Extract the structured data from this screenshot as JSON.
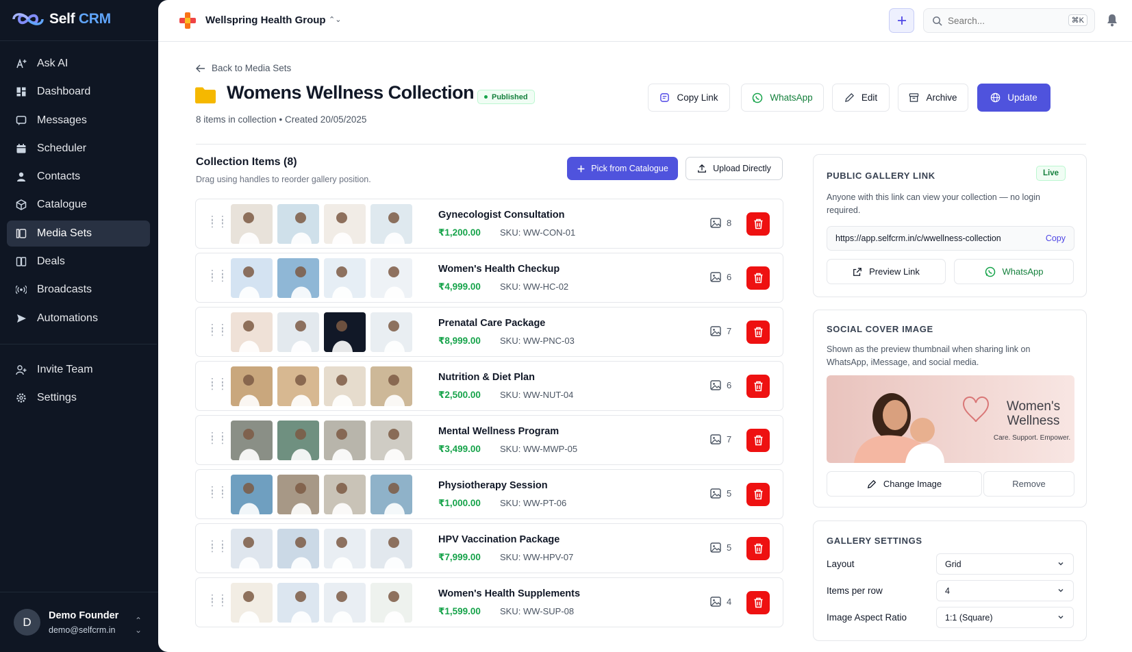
{
  "brand": {
    "name_a": "Self",
    "name_b": "CRM"
  },
  "sidebar": {
    "items": [
      {
        "label": "Ask AI",
        "icon": "sparkle-text-icon"
      },
      {
        "label": "Dashboard",
        "icon": "dashboard-icon"
      },
      {
        "label": "Messages",
        "icon": "messages-icon"
      },
      {
        "label": "Scheduler",
        "icon": "calendar-icon"
      },
      {
        "label": "Contacts",
        "icon": "user-icon"
      },
      {
        "label": "Catalogue",
        "icon": "package-icon"
      },
      {
        "label": "Media Sets",
        "icon": "media-icon"
      },
      {
        "label": "Deals",
        "icon": "book-icon"
      },
      {
        "label": "Broadcasts",
        "icon": "broadcast-icon"
      },
      {
        "label": "Automations",
        "icon": "send-icon"
      }
    ],
    "bottom_items": [
      {
        "label": "Invite Team",
        "icon": "user-plus-icon"
      },
      {
        "label": "Settings",
        "icon": "gear-icon"
      }
    ],
    "active": "Media Sets"
  },
  "user": {
    "initial": "D",
    "name": "Demo Founder",
    "email": "demo@selfcrm.in"
  },
  "topbar": {
    "org_name": "Wellspring Health Group",
    "search_placeholder": "Search...",
    "shortcut": "⌘K"
  },
  "header": {
    "back_label": "Back to Media Sets",
    "title": "Womens Wellness Collection",
    "status": "Published",
    "subtitle": "8 items in collection • Created 20/05/2025",
    "actions": {
      "copy_link": "Copy Link",
      "whatsapp": "WhatsApp",
      "edit": "Edit",
      "archive": "Archive",
      "update": "Update"
    }
  },
  "collection": {
    "title": "Collection Items (8)",
    "subtitle": "Drag using handles to reorder gallery position.",
    "pick_label": "Pick from Catalogue",
    "upload_label": "Upload Directly",
    "items": [
      {
        "name": "Gynecologist Consultation",
        "price": "₹1,200.00",
        "sku": "SKU: WW-CON-01",
        "count": "8"
      },
      {
        "name": "Women's Health Checkup",
        "price": "₹4,999.00",
        "sku": "SKU: WW-HC-02",
        "count": "6"
      },
      {
        "name": "Prenatal Care Package",
        "price": "₹8,999.00",
        "sku": "SKU: WW-PNC-03",
        "count": "7"
      },
      {
        "name": "Nutrition & Diet Plan",
        "price": "₹2,500.00",
        "sku": "SKU: WW-NUT-04",
        "count": "6"
      },
      {
        "name": "Mental Wellness Program",
        "price": "₹3,499.00",
        "sku": "SKU: WW-MWP-05",
        "count": "7"
      },
      {
        "name": "Physiotherapy Session",
        "price": "₹1,000.00",
        "sku": "SKU: WW-PT-06",
        "count": "5"
      },
      {
        "name": "HPV Vaccination Package",
        "price": "₹7,999.00",
        "sku": "SKU: WW-HPV-07",
        "count": "5"
      },
      {
        "name": "Women's Health Supplements",
        "price": "₹1,599.00",
        "sku": "SKU: WW-SUP-08",
        "count": "4"
      }
    ]
  },
  "gallery_link": {
    "title": "PUBLIC GALLERY LINK",
    "status": "Live",
    "description": "Anyone with this link can view your collection — no login required.",
    "url": "https://app.selfcrm.in/c/wwellness-collection",
    "copy_label": "Copy",
    "preview_label": "Preview Link",
    "whatsapp_label": "WhatsApp"
  },
  "social_cover": {
    "title": "SOCIAL COVER IMAGE",
    "description": "Shown as the preview thumbnail when sharing link on WhatsApp, iMessage, and social media.",
    "cover_title_1": "Women's",
    "cover_title_2": "Wellness",
    "cover_tagline": "Care. Support. Empower.",
    "change_label": "Change Image",
    "remove_label": "Remove"
  },
  "gallery_settings": {
    "title": "GALLERY SETTINGS",
    "layout_label": "Layout",
    "layout_value": "Grid",
    "per_row_label": "Items per row",
    "per_row_value": "4",
    "aspect_label": "Image Aspect Ratio",
    "aspect_value": "1:1 (Square)"
  },
  "colors": {
    "accent": "#4f53dd",
    "success": "#16a34a",
    "danger": "#ee1111",
    "sidebar_bg": "#0f1623"
  }
}
